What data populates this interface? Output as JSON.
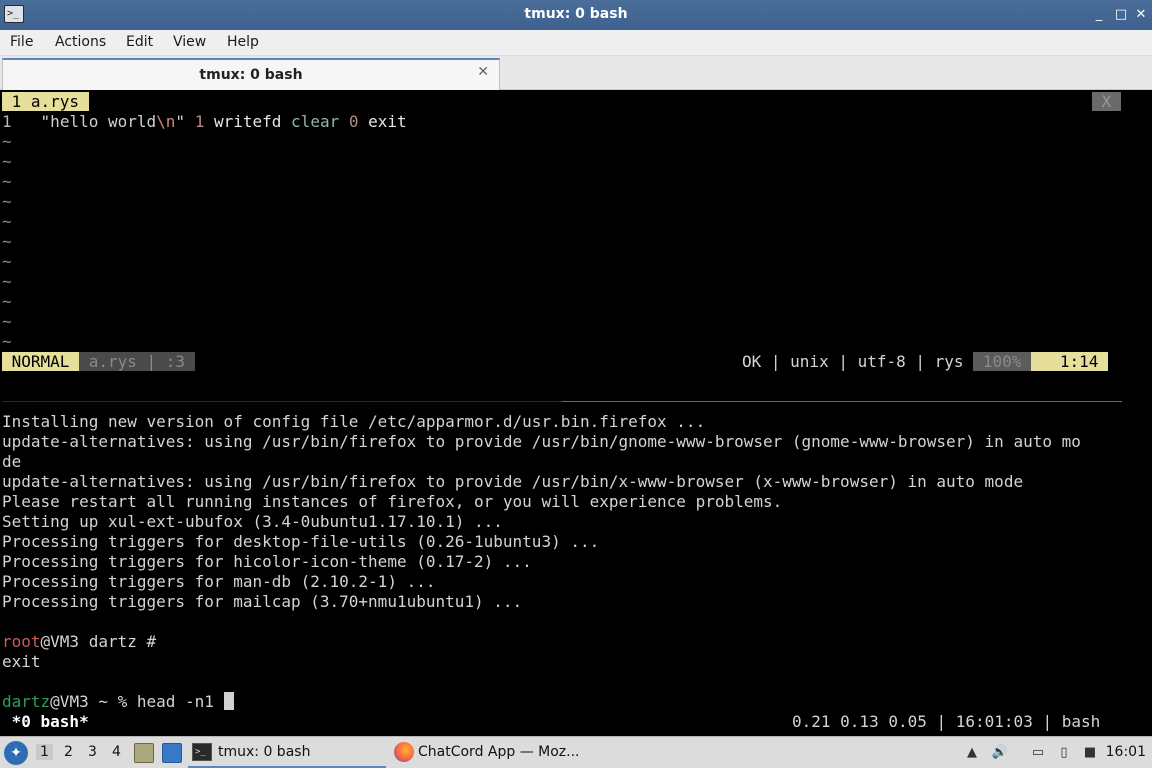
{
  "window": {
    "title": "tmux: 0 bash",
    "minimize_glyph": "_",
    "maximize_glyph": "□",
    "close_glyph": "✕"
  },
  "menu": {
    "items": [
      "File",
      "Actions",
      "Edit",
      "View",
      "Help"
    ]
  },
  "tabbar": {
    "tab_label": "tmux: 0 bash",
    "close_glyph": "✕"
  },
  "vim": {
    "buffer_tab": " 1 a.rys ",
    "close_tab": " X ",
    "line_number": "1",
    "code": {
      "str_open": "\"hello world",
      "escape": "\\n",
      "str_close": "\"",
      "arg_num": "1",
      "writefd": "writefd",
      "clear": "clear",
      "zero": "0",
      "exit": "exit"
    },
    "tilde": "~",
    "statusline": {
      "mode": " NORMAL ",
      "file": " a.rys ",
      "sep": "|",
      "cmd": " :3 ",
      "info": "OK | unix | utf-8 | rys ",
      "percent": " 100% ",
      "position": "   1:14 "
    }
  },
  "shell": {
    "output_lines": [
      "Installing new version of config file /etc/apparmor.d/usr.bin.firefox ...",
      "update-alternatives: using /usr/bin/firefox to provide /usr/bin/gnome-www-browser (gnome-www-browser) in auto mo",
      "de",
      "update-alternatives: using /usr/bin/firefox to provide /usr/bin/x-www-browser (x-www-browser) in auto mode",
      "Please restart all running instances of firefox, or you will experience problems.",
      "Setting up xul-ext-ubufox (3.4-0ubuntu1.17.10.1) ...",
      "Processing triggers for desktop-file-utils (0.26-1ubuntu3) ...",
      "Processing triggers for hicolor-icon-theme (0.17-2) ...",
      "Processing triggers for man-db (2.10.2-1) ...",
      "Processing triggers for mailcap (3.70+nmu1ubuntu1) ..."
    ],
    "root_prompt_user": "root",
    "root_prompt_rest": "@VM3 dartz #",
    "exit_line": "exit",
    "user_prompt_user": "dartz",
    "user_prompt_rest": "@VM3 ~ % head -n1 "
  },
  "tmux": {
    "window_label": " *0 bash*",
    "status_right": "0.21 0.13 0.05 | 16:01:03 | bash"
  },
  "taskbar": {
    "workspaces": [
      "1",
      "2",
      "3",
      "4"
    ],
    "tasks": [
      {
        "label": "tmux: 0 bash",
        "icon": "terminal-icon"
      },
      {
        "label": "ChatCord App — Moz...",
        "icon": "firefox-icon"
      }
    ],
    "clock": "16:01"
  },
  "colors": {
    "titlebar": "#4a6d99",
    "vim_accent": "#e6df9c",
    "prompt_root": "#c75e5e",
    "prompt_user": "#2e9e5e"
  }
}
